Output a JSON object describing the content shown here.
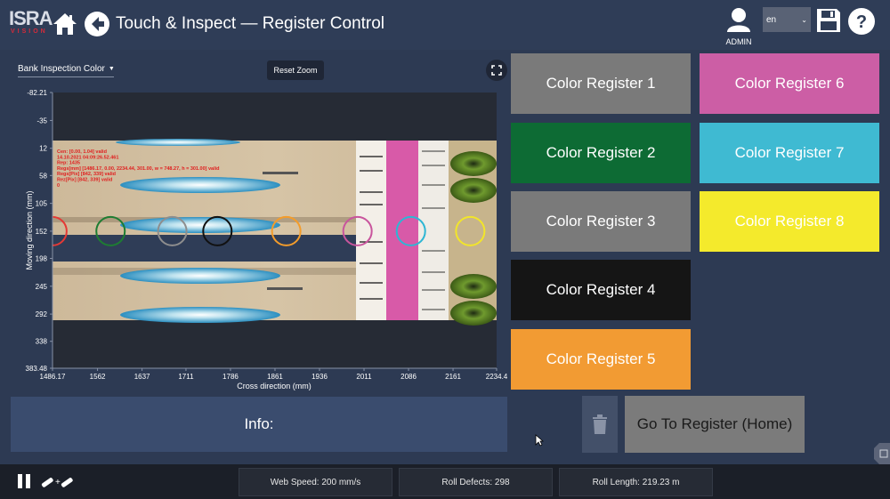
{
  "header": {
    "logo_main": "ISRA",
    "logo_sub": "VISION",
    "title": "Touch & Inspect — Register Control",
    "user_label": "ADMIN",
    "language": "en",
    "icons": [
      "home-icon",
      "back-arrow-icon",
      "user-icon",
      "save-icon",
      "help-icon"
    ]
  },
  "toolbar": {
    "bank_select_value": "Bank Inspection Color",
    "reset_zoom_label": "Reset Zoom"
  },
  "chart_data": {
    "type": "scatter",
    "xlabel": "Cross direction (mm)",
    "ylabel": "Moving direction (mm)",
    "xlim": [
      1486.17,
      2234.4
    ],
    "ylim": [
      -82.21,
      383.48
    ],
    "x_ticks": [
      "1486.17",
      "1562",
      "1637",
      "1711",
      "1786",
      "1861",
      "1936",
      "2011",
      "2086",
      "2161",
      "2234.4"
    ],
    "y_ticks": [
      "-82.21",
      "-35",
      "12",
      "58",
      "105",
      "152",
      "198",
      "245",
      "292",
      "338",
      "383.48"
    ],
    "overlay_text": [
      "Cen: [0.00, 1.04] valid",
      "14.10.2021 04:09:26.52.461",
      "Rep: 1435",
      "Regs[mm] [1486.17, 0.00, 2234.44, 301.00, w = 748.27, h = 301.00] valid",
      "Regs[Pix] [842, 339] valid",
      "Rez[Pix] [842, 339] valid",
      "0"
    ],
    "markers": [
      {
        "color": "#e53935",
        "x": 1486,
        "y": 152
      },
      {
        "color": "#1e7d32",
        "x": 1584,
        "y": 152
      },
      {
        "color": "#8e8e8e",
        "x": 1688,
        "y": 152
      },
      {
        "color": "#111111",
        "x": 1764,
        "y": 152
      },
      {
        "color": "#f39c2b",
        "x": 1880,
        "y": 152
      },
      {
        "color": "#c9559d",
        "x": 2000,
        "y": 152
      },
      {
        "color": "#2eb6d4",
        "x": 2090,
        "y": 152
      },
      {
        "color": "#f2e52a",
        "x": 2190,
        "y": 152
      }
    ]
  },
  "registers": [
    {
      "label": "Color Register 1",
      "bg": "#7a7a7a",
      "fg": "#ffffff"
    },
    {
      "label": "Color Register 2",
      "bg": "#0d6b34",
      "fg": "#ffffff"
    },
    {
      "label": "Color Register 3",
      "bg": "#7a7a7a",
      "fg": "#ffffff"
    },
    {
      "label": "Color Register 4",
      "bg": "#151515",
      "fg": "#ffffff"
    },
    {
      "label": "Color Register 5",
      "bg": "#f29b33",
      "fg": "#ffffff"
    },
    {
      "label": "Color Register 6",
      "bg": "#cc5ea5",
      "fg": "#ffffff"
    },
    {
      "label": "Color Register 7",
      "bg": "#3fbad2",
      "fg": "#ffffff"
    },
    {
      "label": "Color Register 8",
      "bg": "#f4ea2c",
      "fg": "#ffffff"
    }
  ],
  "info": {
    "label": "Info:"
  },
  "actions": {
    "goto_label": "Go To Register (Home)"
  },
  "footer": {
    "web_speed": "Web Speed: 200 mm/s",
    "roll_defects": "Roll Defects: 298",
    "roll_length": "Roll Length: 219.23 m"
  }
}
